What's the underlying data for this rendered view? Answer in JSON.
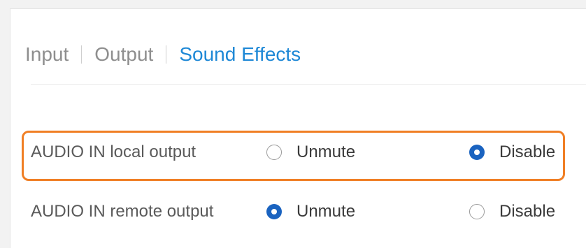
{
  "tabs": [
    {
      "label": "Input",
      "active": false
    },
    {
      "label": "Output",
      "active": false
    },
    {
      "label": "Sound Effects",
      "active": true
    }
  ],
  "rows": [
    {
      "label": "AUDIO IN local output",
      "options": [
        {
          "label": "Unmute",
          "checked": false
        },
        {
          "label": "Disable",
          "checked": true
        }
      ],
      "highlighted": true
    },
    {
      "label": "AUDIO IN remote output",
      "options": [
        {
          "label": "Unmute",
          "checked": true
        },
        {
          "label": "Disable",
          "checked": false
        }
      ],
      "highlighted": false
    }
  ],
  "colors": {
    "accent": "#1e88d6",
    "radio_checked": "#1a63c0",
    "highlight_border": "#f07f25"
  }
}
